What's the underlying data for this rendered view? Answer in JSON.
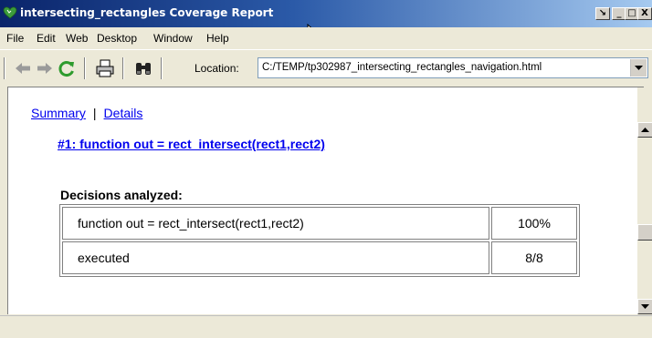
{
  "window": {
    "title": "intersecting_rectangles Coverage Report",
    "icon": "matlab-heart-icon",
    "buttons": {
      "dock": "↘",
      "minimize": "_",
      "maximize": "□",
      "close": "X"
    }
  },
  "menubar": {
    "items": [
      {
        "label": "File"
      },
      {
        "label": "Edit"
      },
      {
        "label": "Web"
      },
      {
        "label": "Desktop"
      },
      {
        "label": "Window"
      },
      {
        "label": "Help"
      }
    ]
  },
  "toolbar": {
    "icons": [
      "back-arrow-icon",
      "forward-arrow-icon",
      "refresh-icon",
      "print-icon",
      "find-icon"
    ],
    "location_label": "Location:",
    "location_value": "C:/TEMP/tp302987_intersecting_rectangles_navigation.html"
  },
  "content": {
    "nav": {
      "summary": "Summary",
      "separator": "|",
      "details": "Details"
    },
    "function_link": "#1: function out = rect_intersect(rect1,rect2)",
    "decisions_heading": "Decisions analyzed:",
    "table": {
      "rows": [
        {
          "label": "function out = rect_intersect(rect1,rect2)",
          "value": "100%"
        },
        {
          "label": "executed",
          "value": "8/8"
        }
      ]
    }
  },
  "colors": {
    "title_bar_start": "#0a246a",
    "title_bar_end": "#a6caf0",
    "link": "#0000ee",
    "chrome": "#ece9d8"
  }
}
